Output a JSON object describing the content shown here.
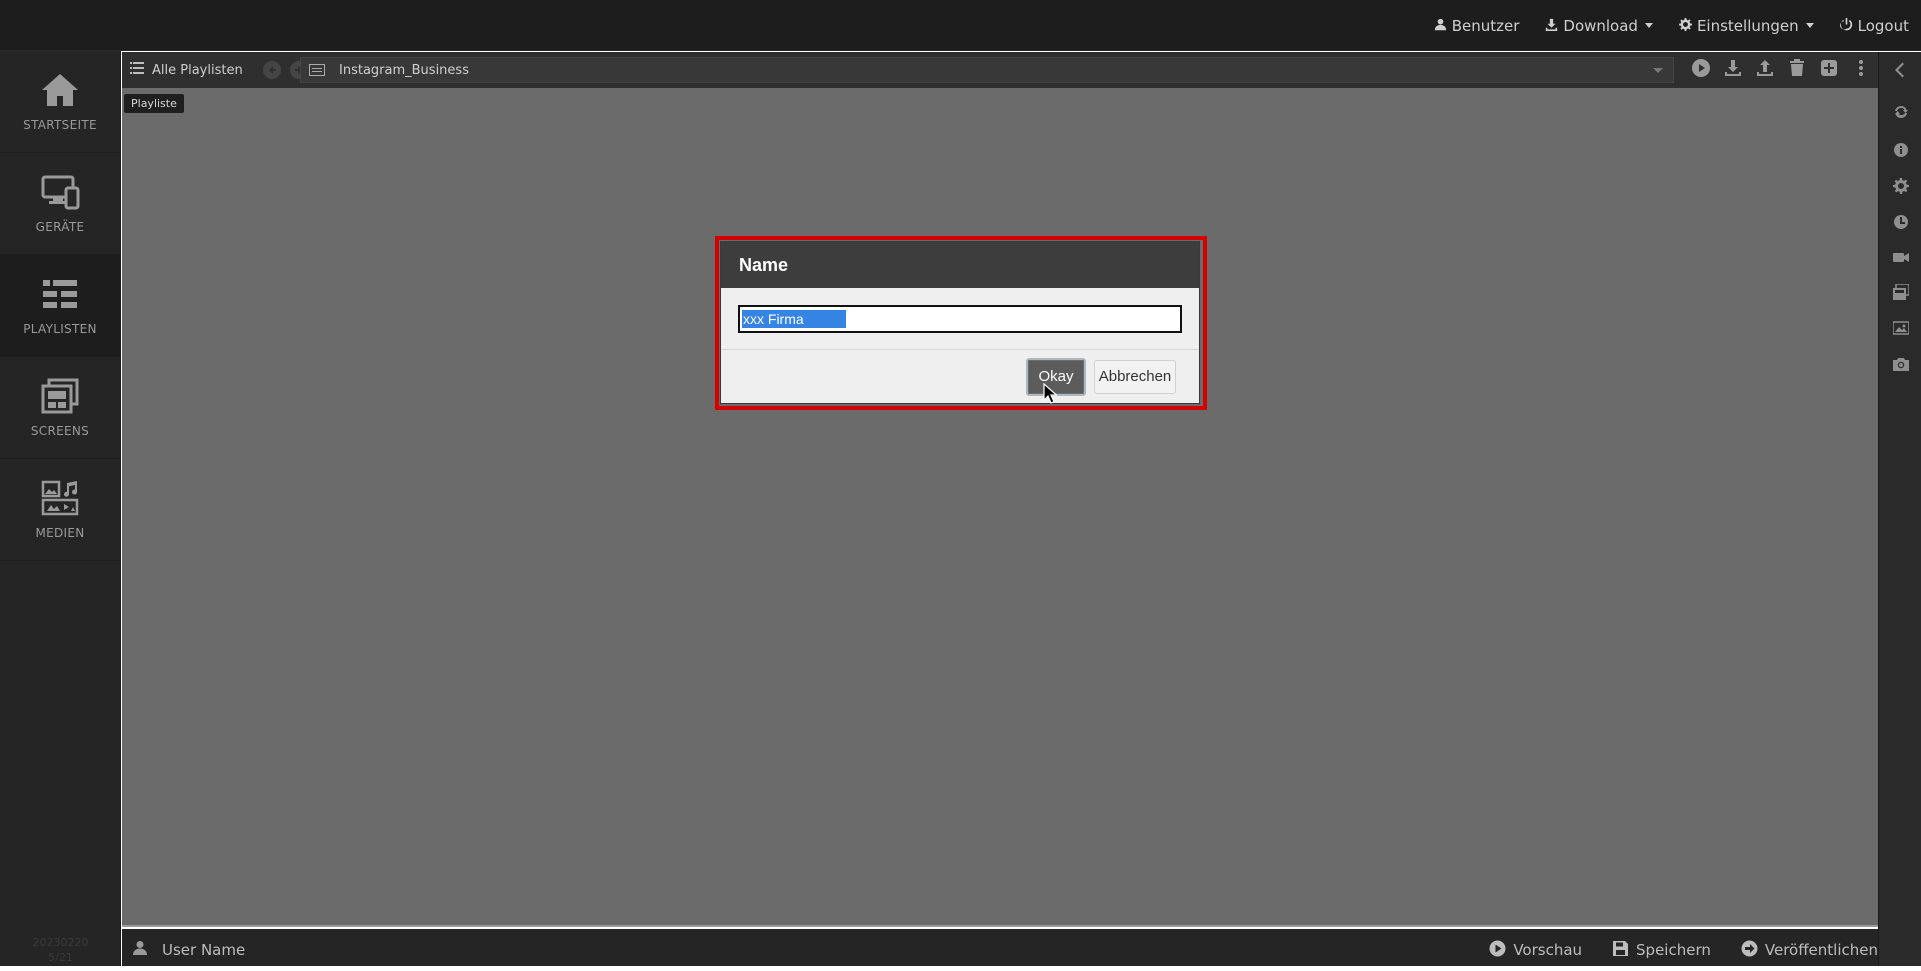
{
  "topbar": {
    "items": [
      {
        "label": "Benutzer",
        "icon": "user-icon"
      },
      {
        "label": "Download",
        "icon": "download-icon"
      },
      {
        "label": "Einstellungen",
        "icon": "gear-icon"
      },
      {
        "label": "Logout",
        "icon": "power-icon"
      }
    ]
  },
  "sidebar": {
    "items": [
      {
        "label": "STARTSEITE",
        "icon": "home-icon"
      },
      {
        "label": "GERÄTE",
        "icon": "devices-icon"
      },
      {
        "label": "PLAYLISTEN",
        "icon": "playlists-icon",
        "active": true
      },
      {
        "label": "SCREENS",
        "icon": "screens-icon"
      },
      {
        "label": "MEDIEN",
        "icon": "media-icon"
      }
    ],
    "version_line1": "20230220",
    "version_line2": "5/21"
  },
  "toolbar": {
    "all_playlists": "Alle Playlisten",
    "current_playlist": "Instagram_Business"
  },
  "workspace": {
    "tag": "Playliste"
  },
  "dialog": {
    "title": "Name",
    "input_value": "xxx Firma",
    "okay_label": "Okay",
    "cancel_label": "Abbrechen",
    "highlight_color": "#d40000"
  },
  "bottombar": {
    "user_name": "User Name",
    "preview_label": "Vorschau",
    "save_label": "Speichern",
    "publish_label": "Veröffentlichen"
  }
}
